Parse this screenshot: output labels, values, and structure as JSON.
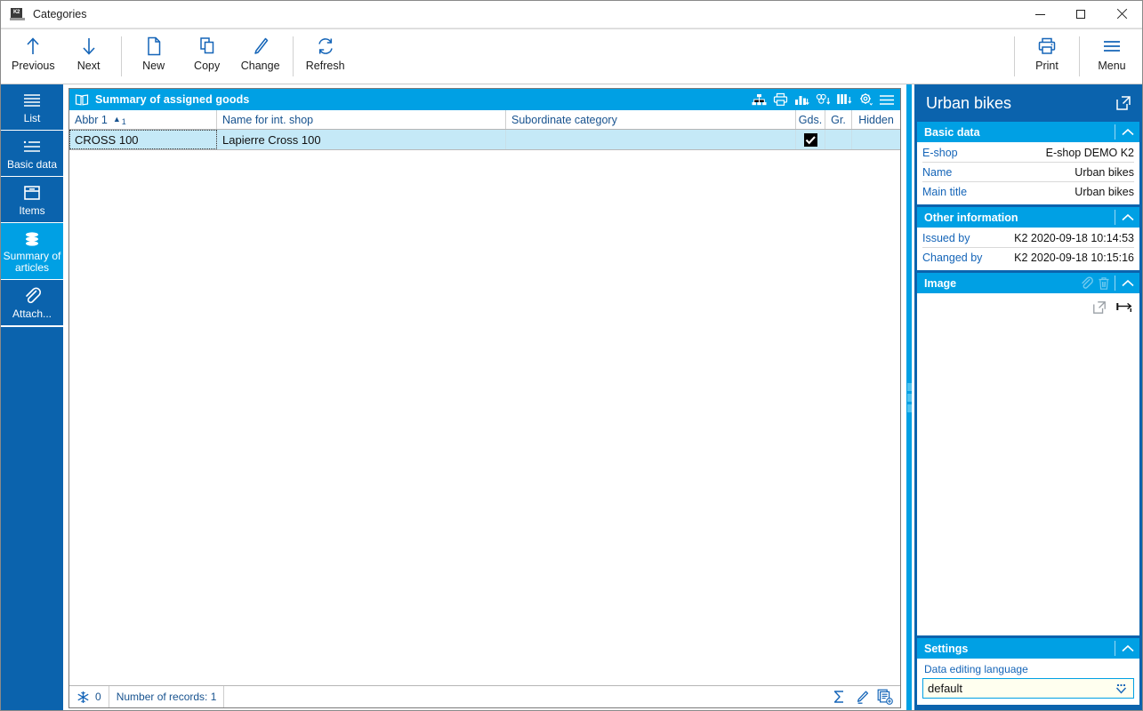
{
  "window": {
    "title": "Categories",
    "app_icon": "k2-app-icon",
    "controls": {
      "minimize": "minimize",
      "maximize": "maximize",
      "close": "close"
    }
  },
  "toolbar": {
    "groups": [
      {
        "buttons": [
          {
            "label": "Previous",
            "icon": "arrow-up-icon"
          },
          {
            "label": "Next",
            "icon": "arrow-down-icon"
          }
        ]
      },
      {
        "buttons": [
          {
            "label": "New",
            "icon": "document-new-icon"
          },
          {
            "label": "Copy",
            "icon": "copy-icon"
          },
          {
            "label": "Change",
            "icon": "pencil-icon"
          }
        ]
      },
      {
        "buttons": [
          {
            "label": "Refresh",
            "icon": "refresh-icon"
          }
        ]
      }
    ],
    "right_buttons": [
      {
        "label": "Print",
        "icon": "printer-icon"
      },
      {
        "label": "Menu",
        "icon": "hamburger-icon"
      }
    ]
  },
  "sidebar": {
    "items": [
      {
        "label": "List",
        "icon": "list-lines-icon",
        "active": false
      },
      {
        "label": "Basic data",
        "icon": "bullet-list-icon",
        "active": false
      },
      {
        "label": "Items",
        "icon": "box-icon",
        "active": false
      },
      {
        "label": "Summary of articles",
        "icon": "layers-icon",
        "active": true
      },
      {
        "label": "Attach...",
        "icon": "paperclip-icon",
        "active": false
      }
    ]
  },
  "grid": {
    "header": {
      "title": "Summary of assigned goods",
      "icon": "book-icon"
    },
    "header_icons": [
      "hierarchy-icon",
      "printer-icon",
      "bar-chart-icon",
      "pivot-icon",
      "columns-icon",
      "settings-gear-icon",
      "menu-icon"
    ],
    "columns": [
      {
        "label": "Abbr 1",
        "sorted": "asc",
        "sort_index": "1"
      },
      {
        "label": "Name for int. shop"
      },
      {
        "label": "Subordinate category"
      },
      {
        "label": "Gds."
      },
      {
        "label": "Gr."
      },
      {
        "label": "Hidden"
      }
    ],
    "rows": [
      {
        "selected": true,
        "abbr": "CROSS 100",
        "name_for_int_shop": "Lapierre Cross 100",
        "subordinate_category": "",
        "gds": true,
        "gr": false,
        "hidden": false
      }
    ],
    "statusbar": {
      "filter_icon": "snowflake-filter-icon",
      "filter_count": "0",
      "records": "Number of records: 1",
      "right_icons": [
        "sum-sigma-icon",
        "edit-pencil-icon",
        "new-record-icon"
      ]
    }
  },
  "right_panel": {
    "title": "Urban bikes",
    "title_action_icon": "open-external-icon",
    "sections": [
      {
        "title": "Basic data",
        "collapse_icon": "chevron-up-icon",
        "fields": [
          {
            "key": "E-shop",
            "value": "E-shop DEMO K2"
          },
          {
            "key": "Name",
            "value": "Urban bikes"
          },
          {
            "key": "Main title",
            "value": "Urban bikes"
          }
        ]
      },
      {
        "title": "Other information",
        "collapse_icon": "chevron-up-icon",
        "fields": [
          {
            "key": "Issued by",
            "value": "K2 2020-09-18 10:14:53"
          },
          {
            "key": "Changed by",
            "value": "K2 2020-09-18 10:15:16"
          }
        ]
      },
      {
        "title": "Image",
        "collapse_icon": "chevron-up-icon",
        "header_icons": [
          "paperclip-icon",
          "trash-icon"
        ],
        "body_icons": [
          "open-external-icon",
          "resize-width-icon"
        ]
      },
      {
        "title": "Settings",
        "collapse_icon": "chevron-up-icon",
        "field_label": "Data editing language",
        "field_value": "default",
        "dropdown_icon": "dropdown-arrow-icon"
      }
    ]
  },
  "colors": {
    "accent_cyan": "#00a0e4",
    "panel_blue": "#0b63ad",
    "icon_blue": "#1565b8",
    "row_selected": "#c5e9f7",
    "combo_bg": "#ffffef"
  }
}
